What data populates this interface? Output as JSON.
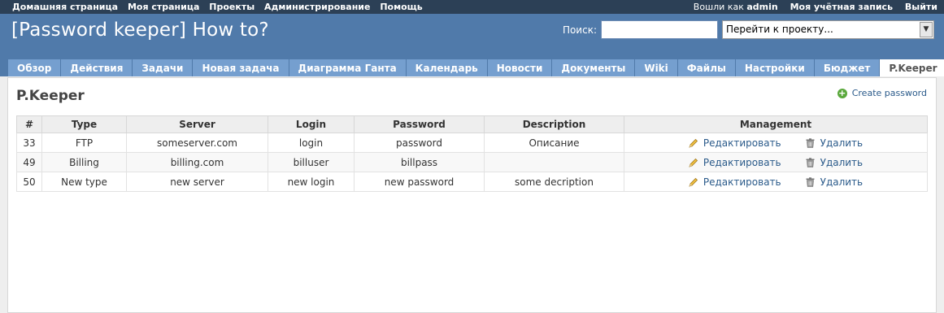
{
  "topmenu": {
    "links": [
      "Домашняя страница",
      "Моя страница",
      "Проекты",
      "Администрирование",
      "Помощь"
    ],
    "logged_prefix": "Вошли как",
    "user": "admin",
    "account": "Моя учётная запись",
    "logout": "Выйти"
  },
  "header": {
    "title": "[Password keeper] How to?",
    "search_label": "Поиск:",
    "search_value": "",
    "jump_select": "Перейти к проекту..."
  },
  "tabs": [
    "Обзор",
    "Действия",
    "Задачи",
    "Новая задача",
    "Диаграмма Ганта",
    "Календарь",
    "Новости",
    "Документы",
    "Wiki",
    "Файлы",
    "Настройки",
    "Бюджет",
    "P.Keeper"
  ],
  "selected_tab": "P.Keeper",
  "page": {
    "title": "P.Keeper",
    "create_link": "Create password"
  },
  "table": {
    "headers": [
      "#",
      "Type",
      "Server",
      "Login",
      "Password",
      "Description",
      "Management"
    ],
    "rows": [
      {
        "id": "33",
        "type": "FTP",
        "server": "someserver.com",
        "login": "login",
        "password": "password",
        "description": "Описание"
      },
      {
        "id": "49",
        "type": "Billing",
        "server": "billing.com",
        "login": "billuser",
        "password": "billpass",
        "description": ""
      },
      {
        "id": "50",
        "type": "New type",
        "server": "new server",
        "login": "new login",
        "password": "new password",
        "description": "some decription"
      }
    ],
    "edit_label": "Редактировать",
    "delete_label": "Удалить"
  },
  "icons": {
    "create": "plus-circle-icon",
    "edit": "pencil-icon",
    "delete": "trash-icon"
  },
  "colors": {
    "topbar": "#2c4056",
    "header": "#507aaa",
    "tab": "#759fcf",
    "link": "#2a5a8a",
    "create_icon": "#5aa83c"
  }
}
